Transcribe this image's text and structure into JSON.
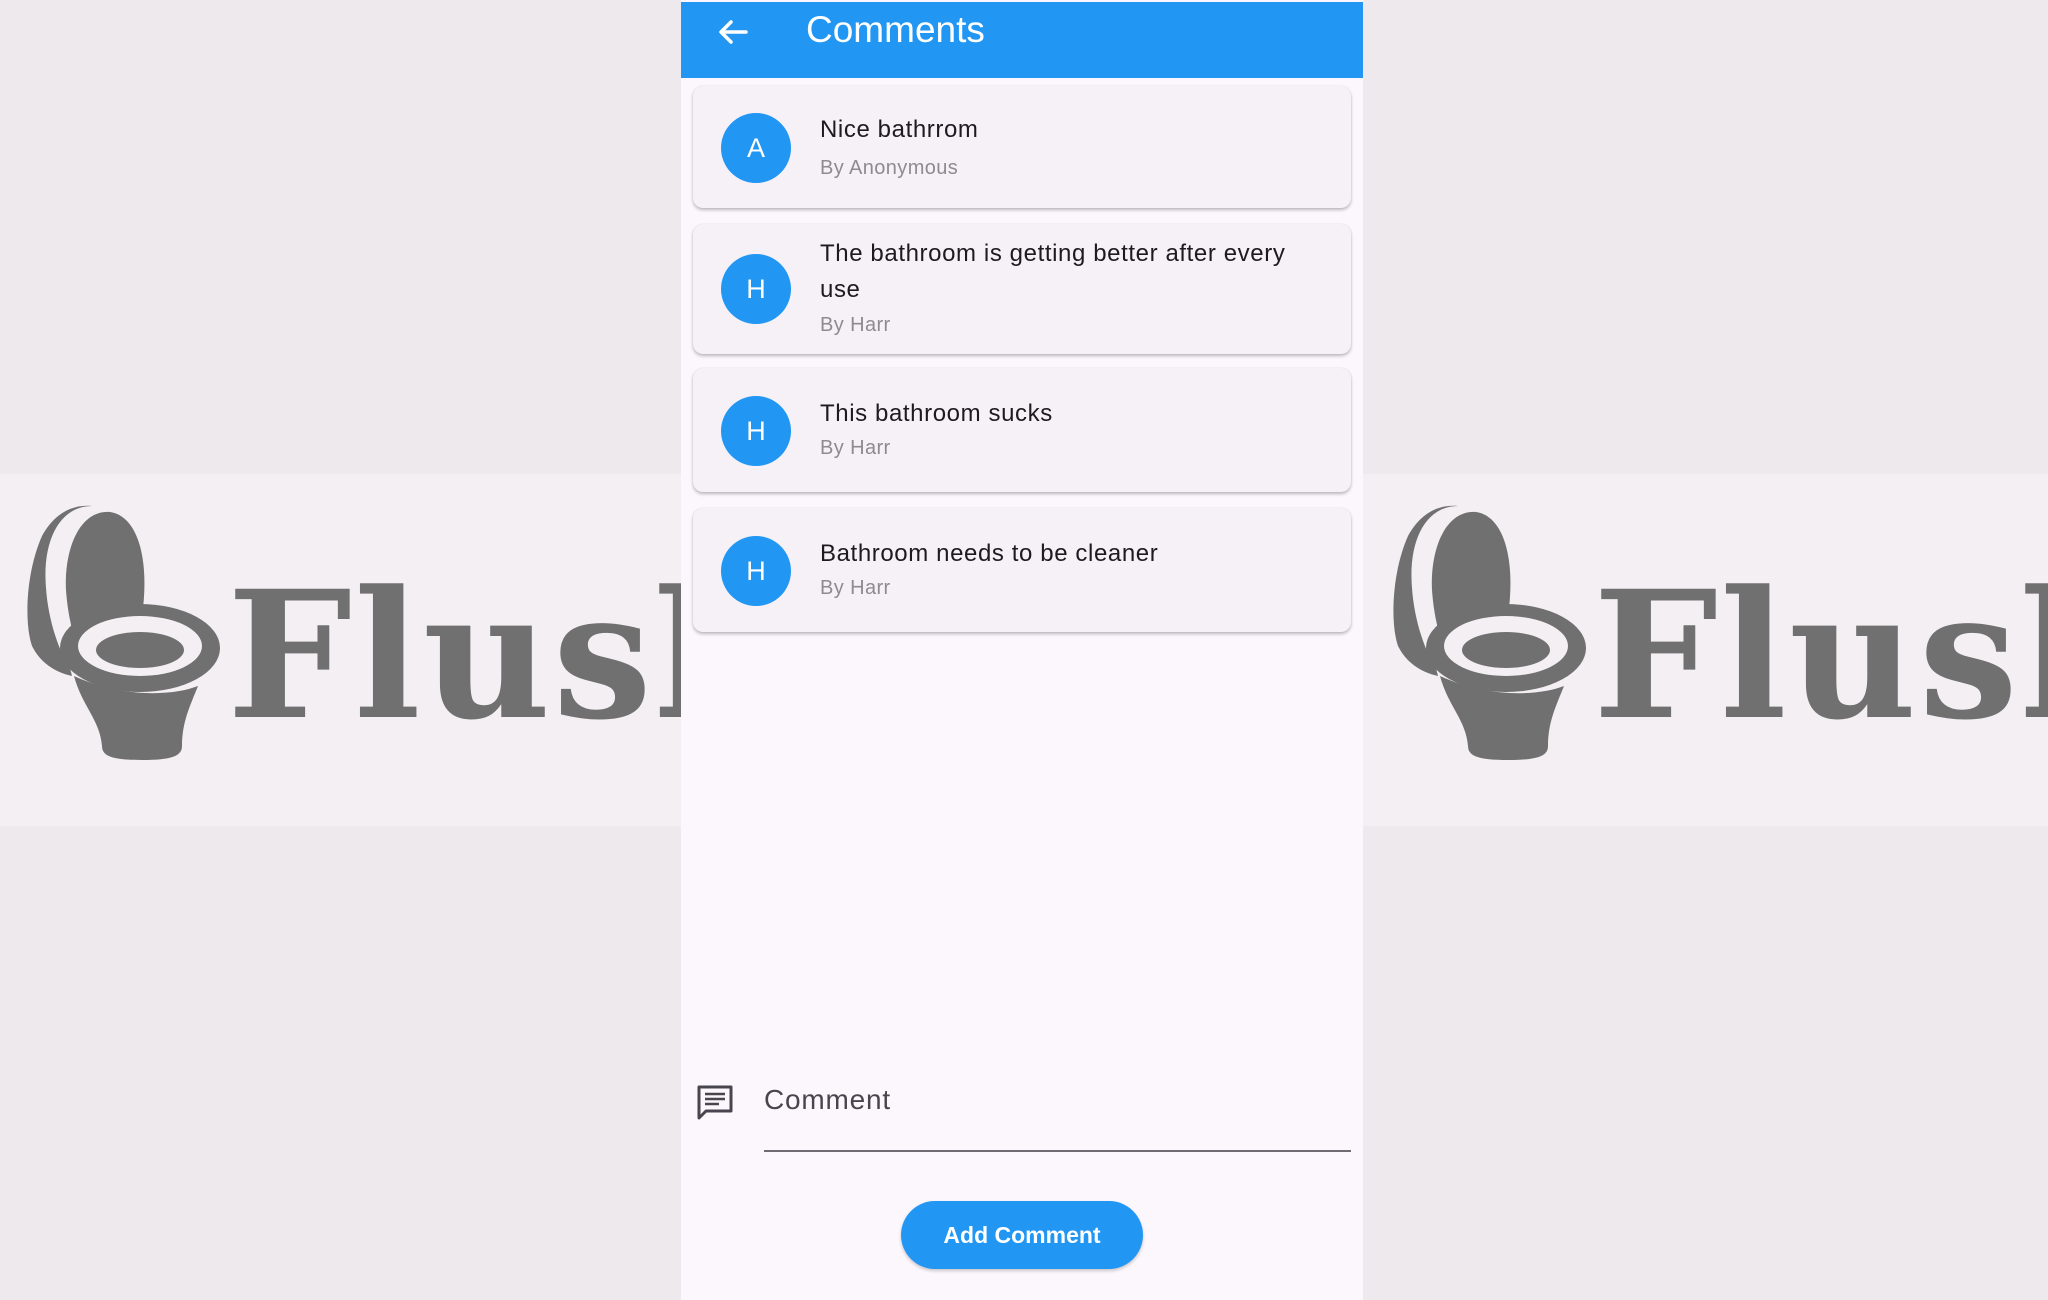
{
  "brand": {
    "name": "Flush",
    "logo_color": "#707070"
  },
  "appbar": {
    "title": "Comments",
    "back_icon": "arrow-back-icon",
    "color": "#2196f3"
  },
  "comments": [
    {
      "avatar": "A",
      "text": "Nice bathrrom",
      "author": "By Anonymous"
    },
    {
      "avatar": "H",
      "text": "The bathroom is getting better after every use",
      "author": "By Harr"
    },
    {
      "avatar": "H",
      "text": "This bathroom sucks",
      "author": "By Harr"
    },
    {
      "avatar": "H",
      "text": "Bathroom needs to be cleaner",
      "author": "By Harr"
    }
  ],
  "comment_input": {
    "placeholder": "Comment",
    "value": "",
    "icon": "comment-icon"
  },
  "add_button": {
    "label": "Add Comment",
    "color": "#2196f3"
  }
}
